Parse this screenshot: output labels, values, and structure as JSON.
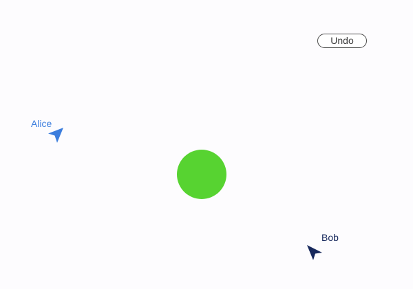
{
  "toolbar": {
    "undo_label": "Undo"
  },
  "canvas": {
    "shape": {
      "type": "circle",
      "color": "#57d331"
    }
  },
  "cursors": [
    {
      "name": "Alice",
      "color": "#3b7ddd",
      "icon": "pointer-arrow-icon"
    },
    {
      "name": "Bob",
      "color": "#17285c",
      "icon": "pointer-arrow-icon"
    }
  ]
}
